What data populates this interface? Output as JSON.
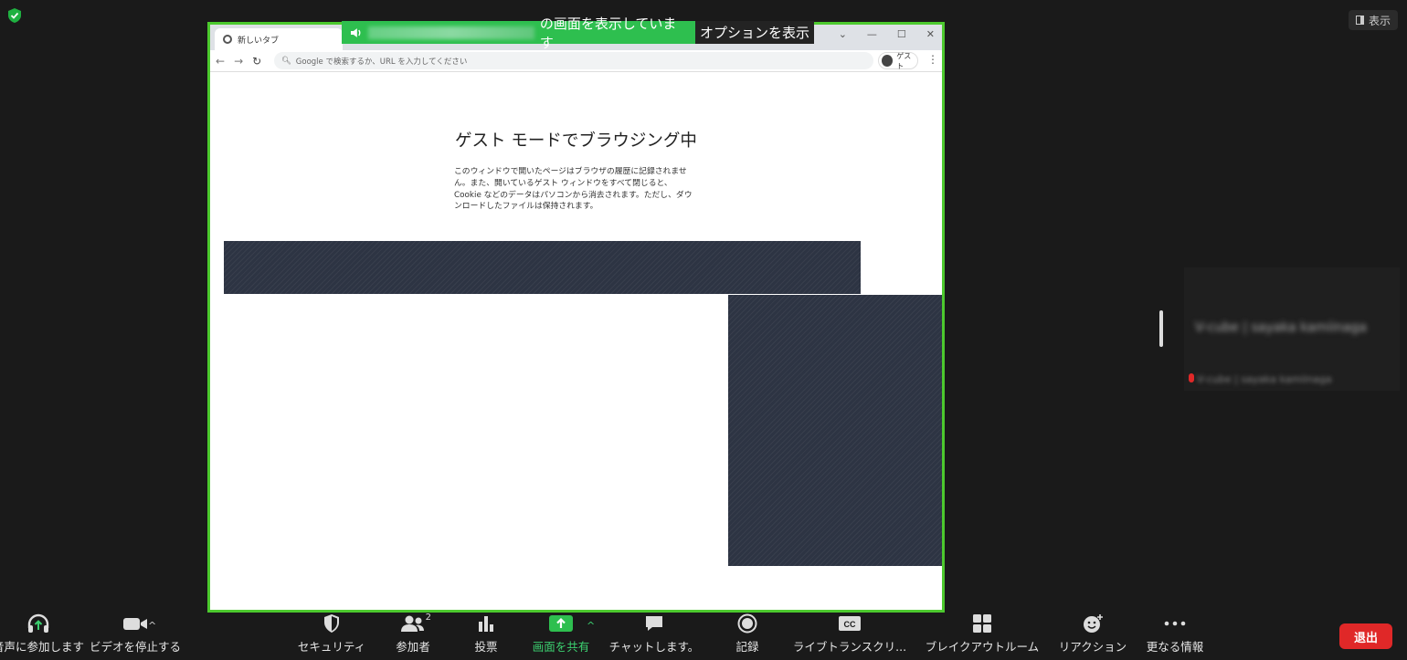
{
  "header": {
    "view_label": "表示"
  },
  "share": {
    "banner_text": "の画面を表示しています",
    "options_label": "オプションを表示"
  },
  "browser": {
    "tab_title": "新しいタブ",
    "omnibox_placeholder": "Google で検索するか、URL を入力してください",
    "profile_label": "ゲスト",
    "guest_title": "ゲスト モードでブラウジング中",
    "guest_desc": "このウィンドウで開いたページはブラウザの履歴に記録されません。また、開いているゲスト ウィンドウをすべて閉じると、Cookie などのデータはパソコンから消去されます。ただし、ダウンロードしたファイルは保持されます。"
  },
  "participant": {
    "name": "V-cube | sayaka kamiinaga",
    "sub": "V-cube | sayaka kamiinaga"
  },
  "toolbar": {
    "audio": "音声に参加します",
    "video": "ビデオを停止する",
    "security": "セキュリティ",
    "participants": "参加者",
    "participants_count": "2",
    "poll": "投票",
    "share": "画面を共有",
    "chat": "チャットします。",
    "record": "記録",
    "transcript": "ライブトランスクリ...",
    "breakout": "ブレイクアウトルーム",
    "reactions": "リアクション",
    "more": "更なる情報",
    "leave": "退出"
  },
  "colors": {
    "accent_green": "#2ebf4f",
    "share_border": "#4cc92e",
    "leave_red": "#e02828",
    "background": "#1a1a1a"
  }
}
